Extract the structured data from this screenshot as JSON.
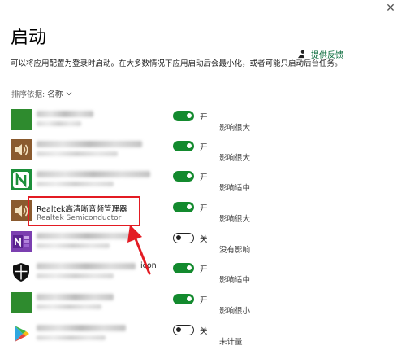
{
  "window": {
    "close_glyph": "✕"
  },
  "header": {
    "title": "启动",
    "feedback_label": "提供反馈"
  },
  "description": "可以将应用配置为登录时启动。在大多数情况下应用启动后会最小化，或者可能只启动后台任务。",
  "sort": {
    "label": "排序依据:",
    "value": "名称"
  },
  "apps": [
    {
      "icon": "green-square-icon",
      "name": "",
      "publisher": "",
      "enabled": true,
      "state": "开",
      "impact": "影响很大"
    },
    {
      "icon": "speaker-icon",
      "name": "",
      "publisher": "",
      "enabled": true,
      "state": "开",
      "impact": "影响很大"
    },
    {
      "icon": "n-app-icon",
      "name": "",
      "publisher": "",
      "enabled": true,
      "state": "开",
      "impact": "影响适中"
    },
    {
      "icon": "speaker-icon",
      "name": "Realtek高清晰音频管理器",
      "publisher": "Realtek Semiconductor",
      "enabled": true,
      "state": "开",
      "impact": "影响很大"
    },
    {
      "icon": "onenote-icon",
      "name": "",
      "publisher": "",
      "enabled": false,
      "state": "关",
      "impact": "没有影响"
    },
    {
      "icon": "shield-icon",
      "name": "",
      "name_tail": "icon",
      "publisher": "",
      "enabled": true,
      "state": "开",
      "impact": "影响适中"
    },
    {
      "icon": "green-square-icon",
      "name": "",
      "publisher": "",
      "enabled": true,
      "state": "开",
      "impact": "影响很小"
    },
    {
      "icon": "play-store-icon",
      "name": "",
      "publisher": "",
      "enabled": false,
      "state": "关",
      "impact": "未计量"
    }
  ],
  "colors": {
    "toggle_on": "#138a2e",
    "highlight": "#e31b23",
    "app_green": "#2e8b2e"
  }
}
